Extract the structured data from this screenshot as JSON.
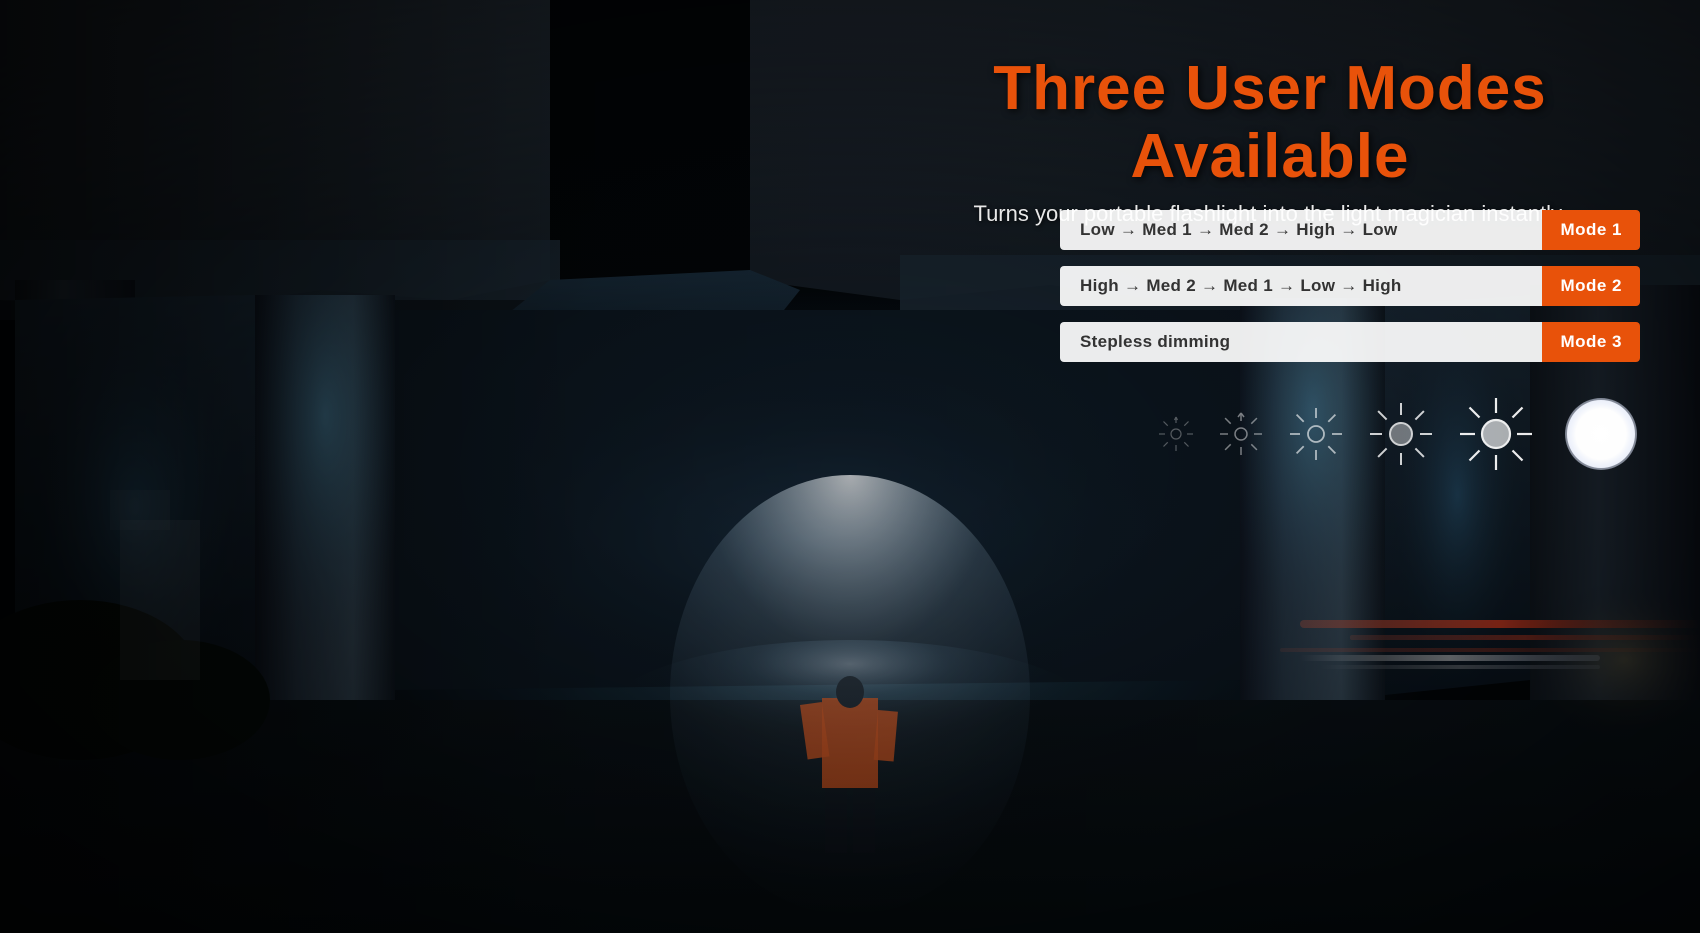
{
  "title": "Three User Modes Available",
  "subtitle": "Turns your portable flashlight into the light magician instantly.",
  "modes": [
    {
      "id": "mode1",
      "sequence": "Low → Med 1 → Med 2 → High → Low",
      "badge": "Mode 1"
    },
    {
      "id": "mode2",
      "sequence": "High → Med 2 → Med 1 → Low → High",
      "badge": "Mode 2"
    },
    {
      "id": "mode3",
      "sequence": "Stepless  dimming",
      "badge": "Mode 3"
    }
  ],
  "brightness_levels": [
    {
      "label": "level-1",
      "size": 38,
      "opacity": 0.35
    },
    {
      "label": "level-2",
      "size": 48,
      "opacity": 0.5
    },
    {
      "label": "level-3",
      "size": 58,
      "opacity": 0.65
    },
    {
      "label": "level-4",
      "size": 68,
      "opacity": 0.8
    },
    {
      "label": "level-5",
      "size": 78,
      "opacity": 0.92
    },
    {
      "label": "level-6",
      "size": 88,
      "opacity": 1.0
    }
  ],
  "colors": {
    "accent": "#e8520a",
    "title": "#e8520a",
    "subtitle": "#e8e8e8",
    "mode_bg": "rgba(255,255,255,0.92)",
    "mode_text": "#333333",
    "badge_bg": "#e8520a",
    "badge_text": "#ffffff"
  }
}
